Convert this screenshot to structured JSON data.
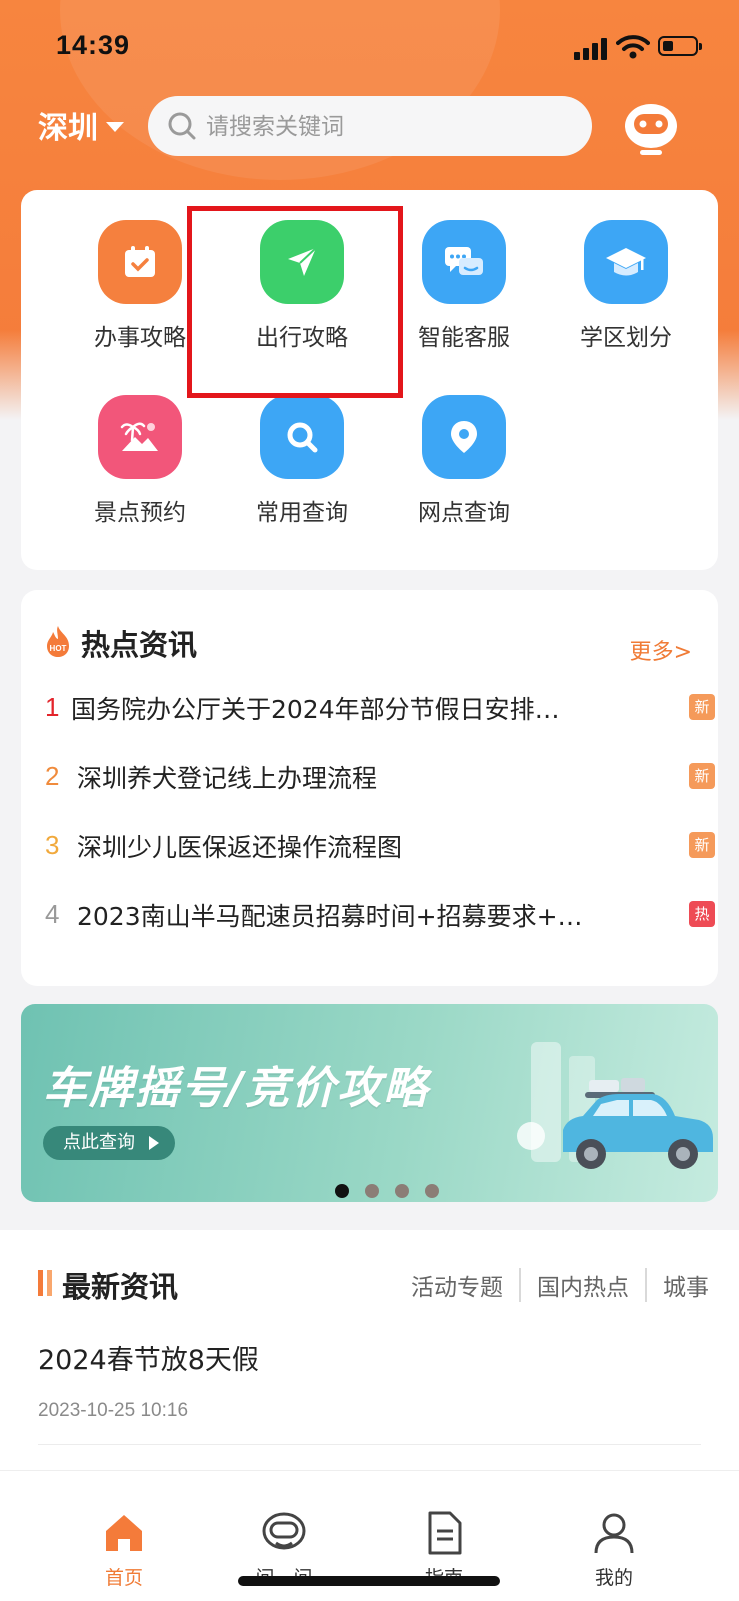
{
  "status_bar": {
    "time": "14:39"
  },
  "header": {
    "city": "深圳",
    "search_placeholder": "请搜索关键词"
  },
  "services": [
    {
      "label": "办事攻略",
      "icon": "calendar-check-icon",
      "color": "#f5803e"
    },
    {
      "label": "出行攻略",
      "icon": "send-arrow-icon",
      "color": "#3ccf6b"
    },
    {
      "label": "智能客服",
      "icon": "chat-bubbles-icon",
      "color": "#3da6f5"
    },
    {
      "label": "学区划分",
      "icon": "graduation-cap-icon",
      "color": "#3da6f5"
    },
    {
      "label": "景点预约",
      "icon": "palm-tree-icon",
      "color": "#f2567a"
    },
    {
      "label": "常用查询",
      "icon": "magnifier-icon",
      "color": "#3da6f5"
    },
    {
      "label": "网点查询",
      "icon": "location-pin-icon",
      "color": "#3da6f5"
    }
  ],
  "hot_news": {
    "title": "热点资讯",
    "more": "更多>",
    "items": [
      {
        "rank": "1",
        "title": "国务院办公厅关于2024年部分节假日安排…",
        "tag": "新",
        "rank_color": "#e3242b",
        "tag_color": "#f59a5a"
      },
      {
        "rank": "2",
        "title": "深圳养犬登记线上办理流程",
        "tag": "新",
        "rank_color": "#f08b3c",
        "tag_color": "#f59a5a"
      },
      {
        "rank": "3",
        "title": "深圳少儿医保返还操作流程图",
        "tag": "新",
        "rank_color": "#f1a93c",
        "tag_color": "#f59a5a"
      },
      {
        "rank": "4",
        "title": "2023南山半马配速员招募时间+招募要求+…",
        "tag": "热",
        "rank_color": "#999999",
        "tag_color": "#ee4b55"
      }
    ]
  },
  "banner": {
    "title": "车牌摇号/竞价攻略",
    "button": "点此查询",
    "active_index": 0,
    "dot_count": 4
  },
  "latest": {
    "title": "最新资讯",
    "tabs": [
      "活动专题",
      "国内热点",
      "城事"
    ],
    "article_title": "2024春节放8天假",
    "article_time": "2023-10-25 10:16"
  },
  "tabbar": [
    {
      "label": "首页",
      "icon": "home-icon",
      "active": true
    },
    {
      "label": "问一问",
      "icon": "robot-icon",
      "active": false
    },
    {
      "label": "指南",
      "icon": "document-icon",
      "active": false
    },
    {
      "label": "我的",
      "icon": "user-icon",
      "active": false
    }
  ]
}
